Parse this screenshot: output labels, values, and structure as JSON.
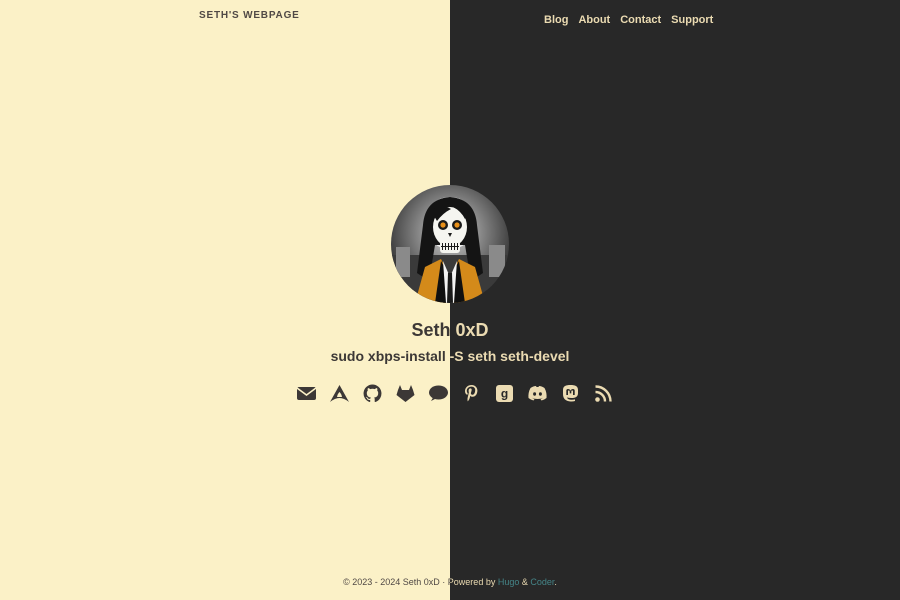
{
  "header": {
    "site_title": "SETH'S WEBPAGE",
    "nav": [
      "Blog",
      "About",
      "Contact",
      "Support"
    ]
  },
  "profile": {
    "name": "Seth 0xD",
    "subtitle": "sudo xbps-install -S seth seth-devel",
    "avatar_alt": "skull-avatar"
  },
  "social_icons": [
    "envelope-icon",
    "arch-linux-icon",
    "github-icon",
    "gitlab-icon",
    "comment-icon",
    "pinterest-icon",
    "goodreads-icon",
    "discord-icon",
    "mastodon-icon",
    "rss-icon"
  ],
  "footer": {
    "copyright": "© 2023 - 2024 Seth 0xD · ",
    "powered_by": "Powered by ",
    "hugo": "Hugo",
    "amp": " & ",
    "coder": "Coder",
    "period": "."
  },
  "colors": {
    "light_bg": "#fbf1c7",
    "dark_bg": "#282828",
    "light_fg": "#3c3836",
    "dark_fg": "#ebdbb2",
    "link": "#458588"
  }
}
